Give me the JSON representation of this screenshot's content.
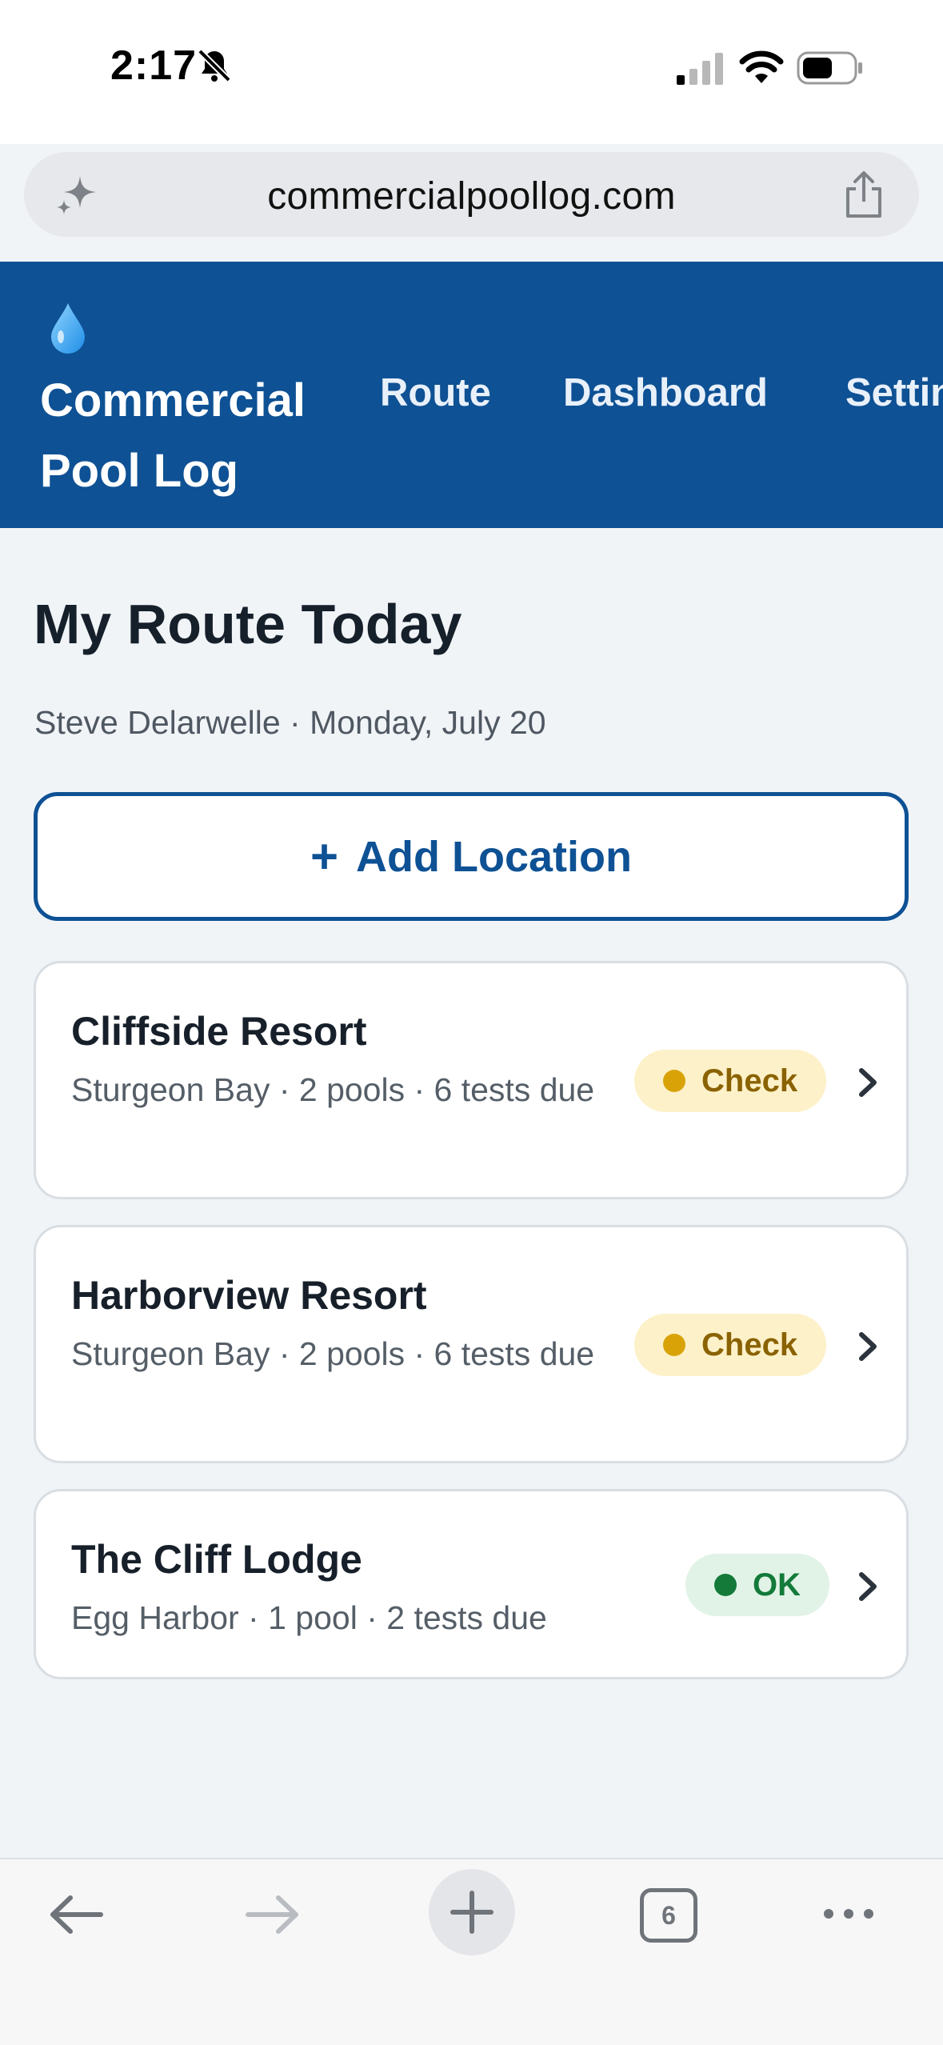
{
  "status_bar": {
    "time": "2:17",
    "icons": [
      "bell-slash-icon",
      "cellular-signal-icon",
      "wifi-icon",
      "battery-icon"
    ]
  },
  "browser": {
    "url": "commercialpoollog.com",
    "tab_count": "6",
    "icons": [
      "sparkle-icon",
      "share-icon",
      "back-arrow-icon",
      "forward-arrow-icon",
      "new-tab-plus-icon",
      "tabs-icon",
      "more-dots-icon"
    ]
  },
  "app": {
    "logo_icon": "water-drop-icon",
    "brand": "Commercial Pool Log",
    "nav": [
      "Route",
      "Dashboard",
      "Settings"
    ]
  },
  "page": {
    "title": "My Route Today",
    "subtitle": "Steve Delarwelle · Monday, July 20",
    "add_button": {
      "plus": "+",
      "label": "Add Location"
    }
  },
  "locations": [
    {
      "name": "Cliffside Resort",
      "meta": "Sturgeon Bay · 2 pools · 6 tests due",
      "status": "Check"
    },
    {
      "name": "Harborview Resort",
      "meta": "Sturgeon Bay · 2 pools · 6 tests due",
      "status": "Check"
    },
    {
      "name": "The Cliff Lodge",
      "meta": "Egg Harbor · 1 pool · 2 tests due",
      "status": "OK"
    }
  ],
  "colors": {
    "header_blue": "#0e5194",
    "check_badge_bg": "#fdf1c9",
    "check_dot": "#d9a308",
    "ok_badge_bg": "#e1f3e6",
    "ok_dot": "#137a3a"
  }
}
